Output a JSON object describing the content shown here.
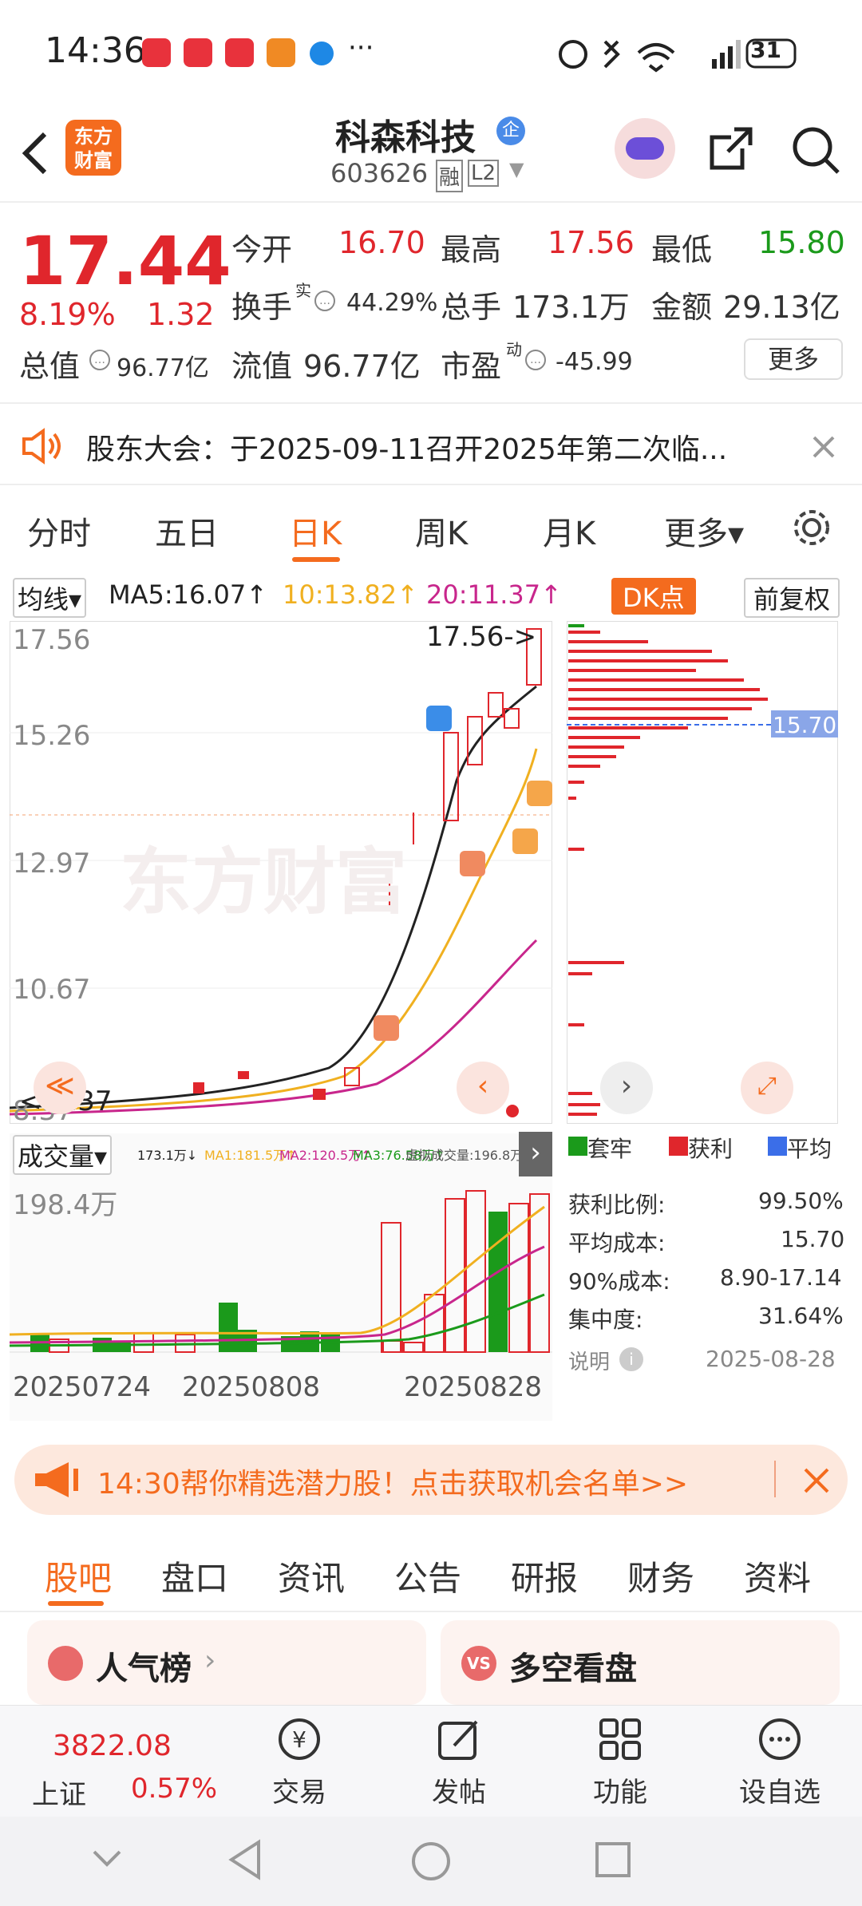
{
  "status": {
    "time": "14:36",
    "battery": "31"
  },
  "header": {
    "name": "科森科技",
    "code": "603626",
    "tag1": "融",
    "tag2": "L2",
    "logo_line1": "东方",
    "logo_line2": "财富",
    "qi": "企"
  },
  "quote": {
    "price": "17.44",
    "pct": "8.19%",
    "chg": "1.32",
    "open_label": "今开",
    "open": "16.70",
    "high_label": "最高",
    "high": "17.56",
    "low_label": "最低",
    "low": "15.80",
    "turnover_label": "换手",
    "turnover_sup": "实",
    "turnover": "44.29%",
    "vol_label": "总手",
    "vol": "173.1万",
    "amt_label": "金额",
    "amt": "29.13亿",
    "mcap_label": "总值",
    "mcap": "96.77亿",
    "float_label": "流值",
    "float": "96.77亿",
    "pe_label": "市盈",
    "pe_sup": "动",
    "pe": "-45.99",
    "more": "更多"
  },
  "notice": {
    "text": "股东大会：于2025-09-11召开2025年第二次临..."
  },
  "period_tabs": [
    "分时",
    "五日",
    "日K",
    "周K",
    "月K",
    "更多▾"
  ],
  "chart": {
    "ma_select": "均线▾",
    "ma5": "MA5:16.07↑",
    "ma10": "10:13.82↑",
    "ma20": "20:11.37↑",
    "dk": "DK点",
    "fq": "前复权",
    "y_labels": [
      "17.56",
      "15.26",
      "12.97",
      "10.67",
      "8.37"
    ],
    "high_note": "17.56->",
    "low_note": "<-8.37",
    "cost_line": "15.70",
    "watermark": "东方财富",
    "vol_select": "成交量▾",
    "vol_info": "173.1万↓",
    "vol_ma1": "MA1:181.5万↑",
    "vol_ma2": "MA2:120.5万↑",
    "vol_ma3": "MA3:76.58万↑",
    "vol_virtual": "虚拟成交量:196.8万",
    "vol_max": "198.4万",
    "dates": [
      "20250724",
      "20250808",
      "20250828"
    ]
  },
  "chips": {
    "legend": [
      "套牢",
      "获利",
      "平均"
    ],
    "rows": [
      {
        "k": "获利比例:",
        "v": "99.50%"
      },
      {
        "k": "平均成本:",
        "v": "15.70"
      },
      {
        "k": "90%成本:",
        "v": "8.90-17.14"
      },
      {
        "k": "集中度:",
        "v": "31.64%"
      }
    ],
    "note": "说明",
    "date": "2025-08-28"
  },
  "ad": {
    "text": "14:30帮你精选潜力股！点击获取机会名单>>"
  },
  "bottom_tabs": [
    "股吧",
    "盘口",
    "资讯",
    "公告",
    "研报",
    "财务",
    "资料"
  ],
  "cards": {
    "c1": "人气榜",
    "c2": "多空看盘"
  },
  "index": {
    "value": "3822.08",
    "name": "上证",
    "pct": "0.57%"
  },
  "nav": [
    "交易",
    "发帖",
    "功能",
    "设自选"
  ],
  "colors": {
    "red": "#e0262c",
    "green": "#1b9a1b",
    "accent": "#ff6a1a",
    "ma10": "#f0b020",
    "ma20": "#c8268c"
  },
  "chart_data": {
    "type": "candlestick",
    "dates_shown": [
      "20250724",
      "20250808",
      "20250828"
    ],
    "ylim": [
      8.37,
      17.56
    ],
    "last": {
      "open": 16.7,
      "high": 17.56,
      "low": 15.8,
      "close": 17.44
    },
    "ma": {
      "ma5": 16.07,
      "ma10": 13.82,
      "ma20": 11.37
    }
  }
}
